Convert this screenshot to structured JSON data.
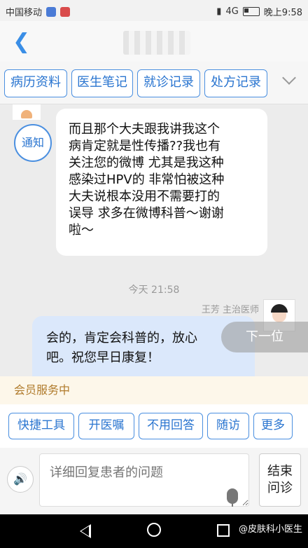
{
  "status_bar": {
    "carrier": "中国移动",
    "network": "4G",
    "time": "晚上9:58"
  },
  "tabs": [
    "病历资料",
    "医生笔记",
    "就诊记录",
    "处方记录"
  ],
  "chat": {
    "notice_label": "通知",
    "patient_message": "而且那个大夫跟我讲我这个\n病肯定就是性传播??我也有\n关注您的微博 尤其是我这种\n感染过HPV的 非常怕被这种\n大夫说根本没用不需要打的\n误导 求多在微博科普～谢谢\n啦～",
    "timestamp": "今天 21:58",
    "doctor_name": "王芳 主治医师",
    "doctor_message": "会的，肯定会科普的，放心\n吧。祝您早日康复！",
    "next_label": "下一位"
  },
  "member_service": "会员服务中",
  "quick_buttons": [
    "快捷工具",
    "开医嘱",
    "不用回答",
    "随访",
    "更多"
  ],
  "input": {
    "placeholder": "详细回复患者的问题",
    "end_label": "结束\n问诊"
  },
  "watermark": "@皮肤科小医生"
}
